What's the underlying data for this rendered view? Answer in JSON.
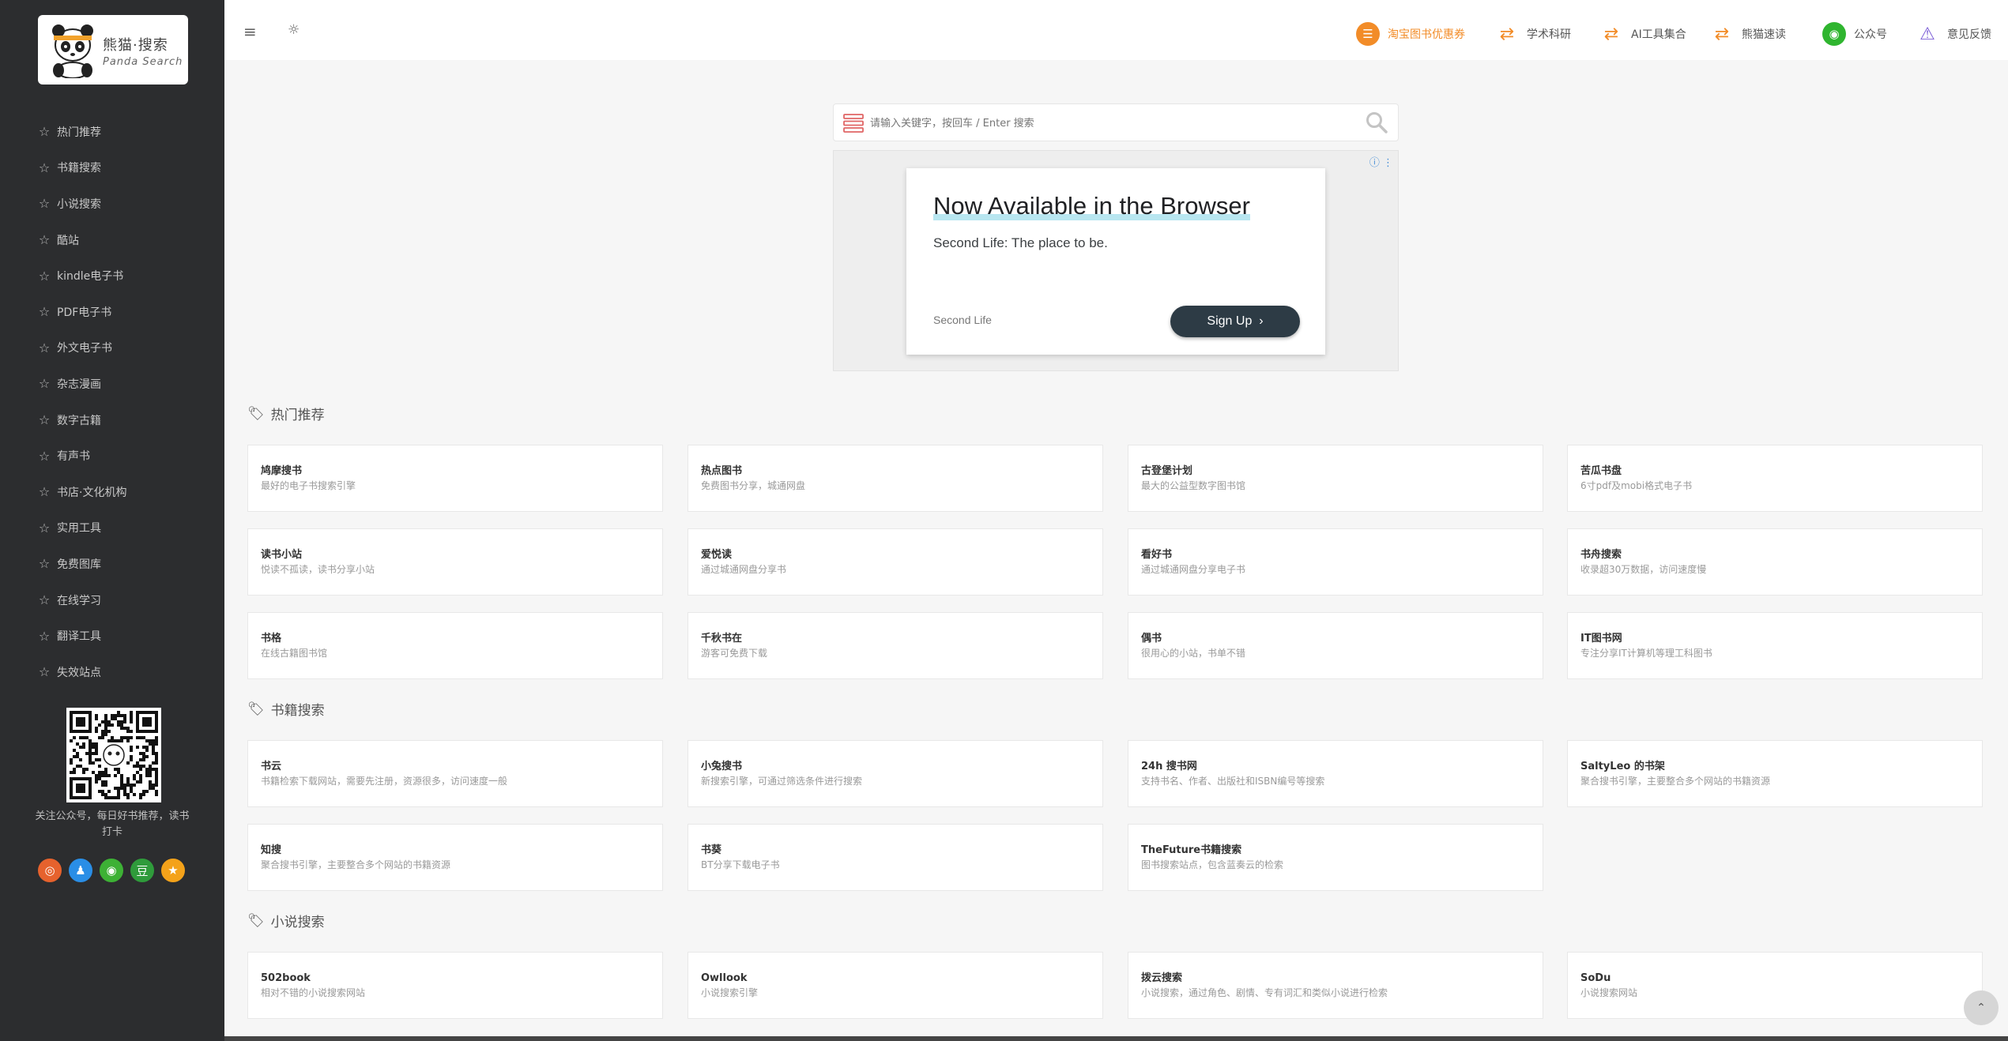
{
  "logo": {
    "title": "熊猫·搜索",
    "subtitle": "Panda Search"
  },
  "sidebar": {
    "items": [
      {
        "label": "热门推荐"
      },
      {
        "label": "书籍搜索"
      },
      {
        "label": "小说搜索"
      },
      {
        "label": "酷站"
      },
      {
        "label": "kindle电子书"
      },
      {
        "label": "PDF电子书"
      },
      {
        "label": "外文电子书"
      },
      {
        "label": "杂志漫画"
      },
      {
        "label": "数字古籍"
      },
      {
        "label": "有声书"
      },
      {
        "label": "书店·文化机构"
      },
      {
        "label": "实用工具"
      },
      {
        "label": "免费图库"
      },
      {
        "label": "在线学习"
      },
      {
        "label": "翻译工具"
      },
      {
        "label": "失效站点"
      }
    ],
    "qr_caption": "关注公众号，每日好书推荐，读书打卡",
    "social": [
      {
        "icon": "weibo-icon",
        "color": "#e6622d"
      },
      {
        "icon": "qq-icon",
        "color": "#2a8ee6"
      },
      {
        "icon": "wechat-icon",
        "color": "#3db135"
      },
      {
        "icon": "douban-icon",
        "color": "#2f9b3b"
      },
      {
        "icon": "star-icon",
        "color": "#f4a21a"
      }
    ]
  },
  "topnav": {
    "links": [
      {
        "label": "淘宝图书优惠券",
        "icon": "coupon-icon",
        "color": "#f28c28"
      },
      {
        "label": "学术科研",
        "icon": "swap-icon",
        "color": "#f28c28"
      },
      {
        "label": "AI工具集合",
        "icon": "swap-icon",
        "color": "#f28c28"
      },
      {
        "label": "熊猫速读",
        "icon": "swap-icon",
        "color": "#f28c28"
      },
      {
        "label": "公众号",
        "icon": "wechat-icon",
        "color": "#2fb52f"
      },
      {
        "label": "意见反馈",
        "icon": "warning-icon",
        "color": "#7b5dd6"
      }
    ]
  },
  "search": {
    "placeholder": "请输入关键字，按回车 / Enter 搜索"
  },
  "ad": {
    "headline": "Now Available in the Browser",
    "sub": "Second Life: The place to be.",
    "advertiser": "Second Life",
    "cta": "Sign Up"
  },
  "sections": [
    {
      "title": "热门推荐",
      "items": [
        {
          "name": "鸠摩搜书",
          "desc": "最好的电子书搜索引擎"
        },
        {
          "name": "热点图书",
          "desc": "免费图书分享，城通网盘"
        },
        {
          "name": "古登堡计划",
          "desc": "最大的公益型数字图书馆"
        },
        {
          "name": "苦瓜书盘",
          "desc": "6寸pdf及mobi格式电子书"
        },
        {
          "name": "读书小站",
          "desc": "悦读不孤读，读书分享小站"
        },
        {
          "name": "爱悦读",
          "desc": "通过城通网盘分享书"
        },
        {
          "name": "看好书",
          "desc": "通过城通网盘分享电子书"
        },
        {
          "name": "书舟搜索",
          "desc": "收录超30万数据，访问速度慢"
        },
        {
          "name": "书格",
          "desc": "在线古籍图书馆"
        },
        {
          "name": "千秋书在",
          "desc": "游客可免费下载"
        },
        {
          "name": "偶书",
          "desc": "很用心的小站，书单不错"
        },
        {
          "name": "IT图书网",
          "desc": "专注分享IT计算机等理工科图书"
        }
      ]
    },
    {
      "title": "书籍搜索",
      "items": [
        {
          "name": "书云",
          "desc": "书籍检索下载网站，需要先注册，资源很多，访问速度一般"
        },
        {
          "name": "小兔搜书",
          "desc": "新搜索引擎，可通过筛选条件进行搜索"
        },
        {
          "name": "24h 搜书网",
          "desc": "支持书名、作者、出版社和ISBN编号等搜索"
        },
        {
          "name": "SaltyLeo 的书架",
          "desc": "聚合搜书引擎，主要整合多个网站的书籍资源"
        },
        {
          "name": "知搜",
          "desc": "聚合搜书引擎，主要整合多个网站的书籍资源"
        },
        {
          "name": "书葵",
          "desc": "BT分享下载电子书"
        },
        {
          "name": "TheFuture书籍搜索",
          "desc": "图书搜索站点，包含蓝奏云的检索"
        }
      ]
    },
    {
      "title": "小说搜索",
      "items": [
        {
          "name": "502book",
          "desc": "相对不错的小说搜索网站"
        },
        {
          "name": "Owllook",
          "desc": "小说搜索引擎"
        },
        {
          "name": "拨云搜索",
          "desc": "小说搜索，通过角色、剧情、专有词汇和类似小说进行检索"
        },
        {
          "name": "SoDu",
          "desc": "小说搜索网站"
        }
      ]
    }
  ]
}
